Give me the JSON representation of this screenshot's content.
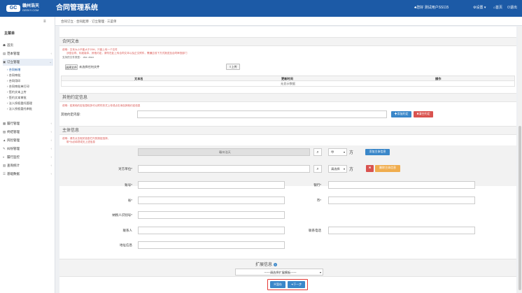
{
  "topbar": {
    "logo_mark": "GC",
    "logo_cn": "赣州浩天",
    "logo_en": "GEEKY.COM",
    "app_title": "合同管理系统",
    "user": "♣您好 测试用户SS115",
    "settings": "⚙设置 ▾",
    "home": "⌂首页",
    "logout": "⏻退出"
  },
  "sidebar": {
    "collapse_icon": "menu-icon",
    "title": "主菜单",
    "items": [
      {
        "icon": "☗",
        "label": "首页"
      },
      {
        "icon": "▤",
        "label": "范本管理"
      },
      {
        "icon": "▣",
        "label": "订立管理"
      },
      {
        "icon": "▦",
        "label": "履行管理"
      },
      {
        "icon": "▨",
        "label": "终结管理"
      },
      {
        "icon": "▲",
        "label": "风险管理"
      },
      {
        "icon": "✎",
        "label": "纠纷管理"
      },
      {
        "icon": "◐",
        "label": "履行监控"
      },
      {
        "icon": "▥",
        "label": "查询统计"
      },
      {
        "icon": "☰",
        "label": "基础数据"
      }
    ],
    "sub_items": [
      "合同新增",
      "合同审批",
      "合同用印",
      "合同审批单打印",
      "签约文本上传",
      "签约文本审批",
      "法人授权委托管理",
      "法人授权委托审批"
    ]
  },
  "breadcrumb": "合同订立 · 合同起草 · 订立管理 · 三菜单",
  "contract_text": {
    "title": "合同文本",
    "note1": "说明：文本大小不能大于20M，只能上传一个文件",
    "note2": "涉密合同、标准版本、其他约定，请勿在此上传合同文本以及正文附件，需通过线下方式报送至合同审查部门",
    "note3": "支持的文件类型：.doc .docx",
    "file_btn": "选择文件",
    "file_placeholder": "未选择任何文件",
    "upload_btn": "⇪上传",
    "columns": [
      "文本名",
      "更新时间",
      "操作"
    ],
    "empty": "无显示数据"
  },
  "other_info": {
    "title": "其他约定信息",
    "note": "说明：若其他约定信息较多可以附件形式上传或点击添加其他约定信息",
    "label": "其他约定内容:",
    "add_btn": "✚添加约定",
    "clear_btn": "✖清空约定"
  },
  "party_info": {
    "title": "主体信息",
    "note1": "说明：请先点击相关信息栏内的按钮选择，",
    "note2": "带*为必填项或无上述信息",
    "our_party": "赣州浩天",
    "type_value": "甲",
    "type_suffix": "方",
    "add_party_btn": "添加主体信息",
    "counterparty_label": "对方单位*",
    "select_value": "请选择",
    "delete_btn": "删除主体信息",
    "fields": [
      {
        "label": "账号*",
        "side": "left"
      },
      {
        "label": "银行*",
        "side": "right"
      },
      {
        "label": "省*",
        "side": "left"
      },
      {
        "label": "市*",
        "side": "right"
      },
      {
        "label": "纳税人识别号*",
        "side": "left"
      },
      {
        "label": "联系人",
        "side": "left"
      },
      {
        "label": "联系电话",
        "side": "right"
      },
      {
        "label": "地址信息",
        "side": "left"
      }
    ]
  },
  "ext_info": {
    "title": "扩展信息",
    "select": "------请选择扩展模板------"
  },
  "actions": {
    "save": "暂存",
    "next": "下一步"
  }
}
